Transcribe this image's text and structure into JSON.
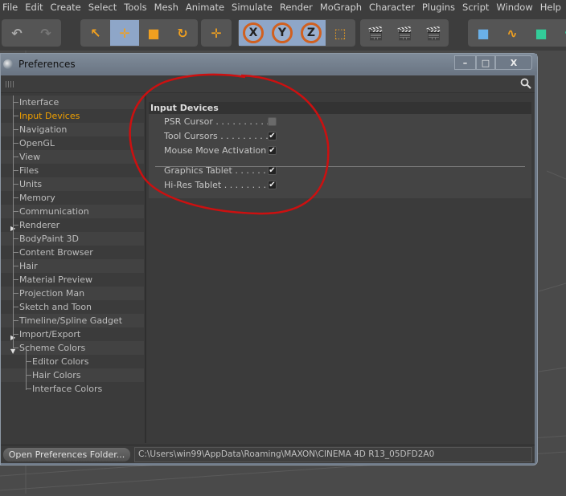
{
  "menubar": [
    "File",
    "Edit",
    "Create",
    "Select",
    "Tools",
    "Mesh",
    "Animate",
    "Simulate",
    "Render",
    "MoGraph",
    "Character",
    "Plugins",
    "Script",
    "Window",
    "Help"
  ],
  "toolbar": {
    "axes": [
      "X",
      "Y",
      "Z"
    ]
  },
  "dialog": {
    "title": "Preferences",
    "controls": {
      "minimize": "–",
      "maximize": "□",
      "close": "X"
    },
    "tree": [
      {
        "label": "Interface"
      },
      {
        "label": "Input Devices",
        "active": true
      },
      {
        "label": "Navigation"
      },
      {
        "label": "OpenGL"
      },
      {
        "label": "View"
      },
      {
        "label": "Files"
      },
      {
        "label": "Units"
      },
      {
        "label": "Memory"
      },
      {
        "label": "Communication"
      },
      {
        "label": "Renderer",
        "expander": "collapsed"
      },
      {
        "label": "BodyPaint 3D"
      },
      {
        "label": "Content Browser"
      },
      {
        "label": "Hair"
      },
      {
        "label": "Material Preview"
      },
      {
        "label": "Projection Man"
      },
      {
        "label": "Sketch and Toon"
      },
      {
        "label": "Timeline/Spline Gadget"
      },
      {
        "label": "Import/Export",
        "expander": "collapsed"
      },
      {
        "label": "Scheme Colors",
        "expander": "expanded"
      },
      {
        "label": "Editor Colors",
        "child": true
      },
      {
        "label": "Hair Colors",
        "child": true
      },
      {
        "label": "Interface Colors",
        "child": true
      }
    ],
    "section_title": "Input Devices",
    "options": [
      {
        "label": "PSR Cursor . . . . . . . . . . .",
        "checked": false
      },
      {
        "label": "Tool Cursors . . . . . . . . . .",
        "checked": true
      },
      {
        "label": "Mouse Move Activation",
        "checked": true
      },
      {
        "label": "Graphics Tablet . . . . . . .",
        "checked": true
      },
      {
        "label": "Hi-Res Tablet . . . . . . . .",
        "checked": true
      }
    ],
    "open_folder_button": "Open Preferences Folder...",
    "path": "C:\\Users\\win99\\AppData\\Roaming\\MAXON\\CINEMA 4D R13_05DFD2A0"
  },
  "colors": {
    "active_item": "#f0a000",
    "annotation": "#cc1010"
  }
}
